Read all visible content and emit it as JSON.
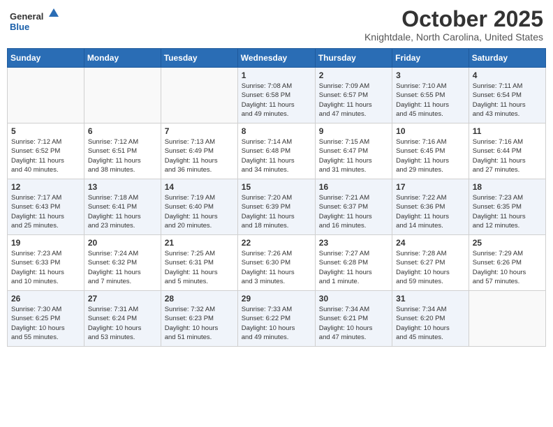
{
  "header": {
    "logo_general": "General",
    "logo_blue": "Blue",
    "month_title": "October 2025",
    "location": "Knightdale, North Carolina, United States"
  },
  "days_of_week": [
    "Sunday",
    "Monday",
    "Tuesday",
    "Wednesday",
    "Thursday",
    "Friday",
    "Saturday"
  ],
  "weeks": [
    [
      {
        "day": "",
        "info": ""
      },
      {
        "day": "",
        "info": ""
      },
      {
        "day": "",
        "info": ""
      },
      {
        "day": "1",
        "info": "Sunrise: 7:08 AM\nSunset: 6:58 PM\nDaylight: 11 hours\nand 49 minutes."
      },
      {
        "day": "2",
        "info": "Sunrise: 7:09 AM\nSunset: 6:57 PM\nDaylight: 11 hours\nand 47 minutes."
      },
      {
        "day": "3",
        "info": "Sunrise: 7:10 AM\nSunset: 6:55 PM\nDaylight: 11 hours\nand 45 minutes."
      },
      {
        "day": "4",
        "info": "Sunrise: 7:11 AM\nSunset: 6:54 PM\nDaylight: 11 hours\nand 43 minutes."
      }
    ],
    [
      {
        "day": "5",
        "info": "Sunrise: 7:12 AM\nSunset: 6:52 PM\nDaylight: 11 hours\nand 40 minutes."
      },
      {
        "day": "6",
        "info": "Sunrise: 7:12 AM\nSunset: 6:51 PM\nDaylight: 11 hours\nand 38 minutes."
      },
      {
        "day": "7",
        "info": "Sunrise: 7:13 AM\nSunset: 6:49 PM\nDaylight: 11 hours\nand 36 minutes."
      },
      {
        "day": "8",
        "info": "Sunrise: 7:14 AM\nSunset: 6:48 PM\nDaylight: 11 hours\nand 34 minutes."
      },
      {
        "day": "9",
        "info": "Sunrise: 7:15 AM\nSunset: 6:47 PM\nDaylight: 11 hours\nand 31 minutes."
      },
      {
        "day": "10",
        "info": "Sunrise: 7:16 AM\nSunset: 6:45 PM\nDaylight: 11 hours\nand 29 minutes."
      },
      {
        "day": "11",
        "info": "Sunrise: 7:16 AM\nSunset: 6:44 PM\nDaylight: 11 hours\nand 27 minutes."
      }
    ],
    [
      {
        "day": "12",
        "info": "Sunrise: 7:17 AM\nSunset: 6:43 PM\nDaylight: 11 hours\nand 25 minutes."
      },
      {
        "day": "13",
        "info": "Sunrise: 7:18 AM\nSunset: 6:41 PM\nDaylight: 11 hours\nand 23 minutes."
      },
      {
        "day": "14",
        "info": "Sunrise: 7:19 AM\nSunset: 6:40 PM\nDaylight: 11 hours\nand 20 minutes."
      },
      {
        "day": "15",
        "info": "Sunrise: 7:20 AM\nSunset: 6:39 PM\nDaylight: 11 hours\nand 18 minutes."
      },
      {
        "day": "16",
        "info": "Sunrise: 7:21 AM\nSunset: 6:37 PM\nDaylight: 11 hours\nand 16 minutes."
      },
      {
        "day": "17",
        "info": "Sunrise: 7:22 AM\nSunset: 6:36 PM\nDaylight: 11 hours\nand 14 minutes."
      },
      {
        "day": "18",
        "info": "Sunrise: 7:23 AM\nSunset: 6:35 PM\nDaylight: 11 hours\nand 12 minutes."
      }
    ],
    [
      {
        "day": "19",
        "info": "Sunrise: 7:23 AM\nSunset: 6:33 PM\nDaylight: 11 hours\nand 10 minutes."
      },
      {
        "day": "20",
        "info": "Sunrise: 7:24 AM\nSunset: 6:32 PM\nDaylight: 11 hours\nand 7 minutes."
      },
      {
        "day": "21",
        "info": "Sunrise: 7:25 AM\nSunset: 6:31 PM\nDaylight: 11 hours\nand 5 minutes."
      },
      {
        "day": "22",
        "info": "Sunrise: 7:26 AM\nSunset: 6:30 PM\nDaylight: 11 hours\nand 3 minutes."
      },
      {
        "day": "23",
        "info": "Sunrise: 7:27 AM\nSunset: 6:28 PM\nDaylight: 11 hours\nand 1 minute."
      },
      {
        "day": "24",
        "info": "Sunrise: 7:28 AM\nSunset: 6:27 PM\nDaylight: 10 hours\nand 59 minutes."
      },
      {
        "day": "25",
        "info": "Sunrise: 7:29 AM\nSunset: 6:26 PM\nDaylight: 10 hours\nand 57 minutes."
      }
    ],
    [
      {
        "day": "26",
        "info": "Sunrise: 7:30 AM\nSunset: 6:25 PM\nDaylight: 10 hours\nand 55 minutes."
      },
      {
        "day": "27",
        "info": "Sunrise: 7:31 AM\nSunset: 6:24 PM\nDaylight: 10 hours\nand 53 minutes."
      },
      {
        "day": "28",
        "info": "Sunrise: 7:32 AM\nSunset: 6:23 PM\nDaylight: 10 hours\nand 51 minutes."
      },
      {
        "day": "29",
        "info": "Sunrise: 7:33 AM\nSunset: 6:22 PM\nDaylight: 10 hours\nand 49 minutes."
      },
      {
        "day": "30",
        "info": "Sunrise: 7:34 AM\nSunset: 6:21 PM\nDaylight: 10 hours\nand 47 minutes."
      },
      {
        "day": "31",
        "info": "Sunrise: 7:34 AM\nSunset: 6:20 PM\nDaylight: 10 hours\nand 45 minutes."
      },
      {
        "day": "",
        "info": ""
      }
    ]
  ]
}
